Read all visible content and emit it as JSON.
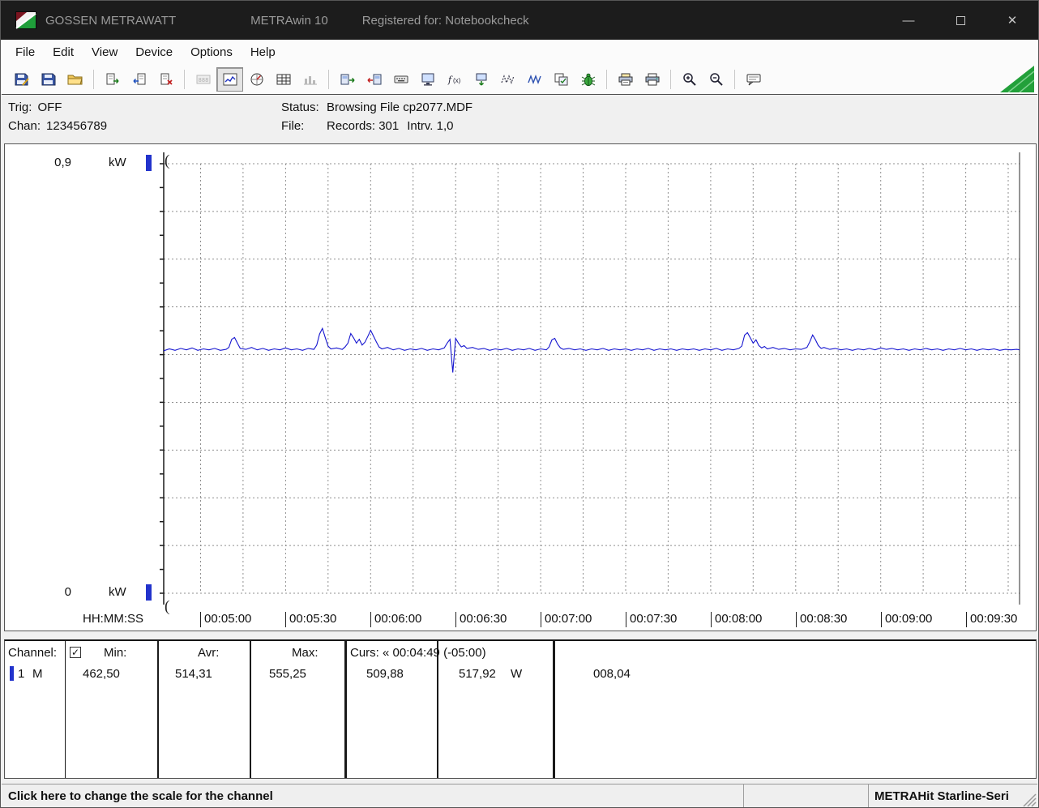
{
  "titlebar": {
    "app_name": "GOSSEN METRAWATT",
    "app_title": "METRAwin 10",
    "registered": "Registered for: Notebookcheck",
    "minimize_glyph": "—",
    "close_glyph": "✕"
  },
  "menu": {
    "items": [
      "File",
      "Edit",
      "View",
      "Device",
      "Options",
      "Help"
    ]
  },
  "toolbar": {
    "accent_triangle_color": "#22a03a",
    "groups": [
      [
        {
          "name": "save-record",
          "icon": "disk-pen"
        },
        {
          "name": "save-file",
          "icon": "disk"
        },
        {
          "name": "open-file",
          "icon": "folder"
        }
      ],
      [
        {
          "name": "export-data",
          "icon": "doc-right"
        },
        {
          "name": "import-data",
          "icon": "doc-left"
        },
        {
          "name": "close-file",
          "icon": "doc-red"
        }
      ],
      [
        {
          "name": "view-numeric",
          "icon": "lcd",
          "disabled": true
        },
        {
          "name": "view-trend-chart",
          "icon": "chart",
          "pressed": true
        },
        {
          "name": "view-analog-meter",
          "icon": "dial"
        },
        {
          "name": "view-table",
          "icon": "table"
        },
        {
          "name": "view-histogram",
          "icon": "bars",
          "disabled": true
        }
      ],
      [
        {
          "name": "device-send",
          "icon": "dev-send"
        },
        {
          "name": "device-receive",
          "icon": "dev-recv"
        },
        {
          "name": "device-program",
          "icon": "kbd"
        },
        {
          "name": "pc-transfer",
          "icon": "monitor"
        },
        {
          "name": "formula",
          "icon": "fx"
        },
        {
          "name": "device-memory",
          "icon": "mem"
        },
        {
          "name": "signal-dashed",
          "icon": "wave"
        },
        {
          "name": "signal-solid",
          "icon": "wave2"
        },
        {
          "name": "copy-settings",
          "icon": "copy"
        },
        {
          "name": "live-mode",
          "icon": "bug"
        }
      ],
      [
        {
          "name": "print-preview",
          "icon": "preview"
        },
        {
          "name": "print",
          "icon": "print"
        }
      ],
      [
        {
          "name": "zoom-in",
          "icon": "zoomin"
        },
        {
          "name": "zoom-out",
          "icon": "zoomout"
        }
      ],
      [
        {
          "name": "annotation",
          "icon": "note"
        }
      ]
    ]
  },
  "status_panel": {
    "trig_label": "Trig:",
    "trig_value": "OFF",
    "chan_label": "Chan:",
    "chan_value": "123456789",
    "status_label": "Status:",
    "status_value": "Browsing File cp2077.MDF",
    "file_label": "File:",
    "file_records": "Records: 301",
    "file_interval": "Intrv. 1,0"
  },
  "chart": {
    "y_max_label": "0,9",
    "y_min_label": "0",
    "y_unit": "kW",
    "x_axis_label": "HH:MM:SS",
    "line_color": "#1515cf",
    "marker_color": "#2233cc"
  },
  "chart_data": {
    "type": "line",
    "title": "",
    "xlabel": "HH:MM:SS",
    "ylabel": "kW",
    "ylim_kw": [
      0,
      0.9
    ],
    "y_gridline_step_kw": 0.1,
    "x_gridline_step_s": 15,
    "x_range_s": [
      287,
      589
    ],
    "x_ticks": [
      {
        "t": 300,
        "label": "00:05:00"
      },
      {
        "t": 330,
        "label": "00:05:30"
      },
      {
        "t": 360,
        "label": "00:06:00"
      },
      {
        "t": 390,
        "label": "00:06:30"
      },
      {
        "t": 420,
        "label": "00:07:00"
      },
      {
        "t": 450,
        "label": "00:07:30"
      },
      {
        "t": 480,
        "label": "00:08:00"
      },
      {
        "t": 510,
        "label": "00:08:30"
      },
      {
        "t": 540,
        "label": "00:09:00"
      },
      {
        "t": 570,
        "label": "00:09:30"
      }
    ],
    "cursors": {
      "c1_time": "00:04:49",
      "span": "(-05:00)",
      "c1_value_w": 509.88,
      "c2_value_w": 517.92,
      "delta_w": 8.04
    },
    "stats": {
      "min_w": 462.5,
      "avr_w": 514.31,
      "max_w": 555.25,
      "records": 301,
      "interval_s": 1.0
    },
    "series": [
      {
        "name": "Channel 1 power (W)",
        "color": "#1515cf",
        "points": [
          [
            287,
            508
          ],
          [
            289,
            512
          ],
          [
            291,
            509
          ],
          [
            293,
            513
          ],
          [
            295,
            510
          ],
          [
            297,
            514
          ],
          [
            299,
            509
          ],
          [
            301,
            512
          ],
          [
            303,
            510
          ],
          [
            305,
            513
          ],
          [
            307,
            509
          ],
          [
            309,
            511
          ],
          [
            310,
            515
          ],
          [
            311,
            532
          ],
          [
            312,
            536
          ],
          [
            313,
            524
          ],
          [
            314,
            513
          ],
          [
            316,
            511
          ],
          [
            318,
            515
          ],
          [
            320,
            510
          ],
          [
            322,
            513
          ],
          [
            324,
            509
          ],
          [
            326,
            512
          ],
          [
            328,
            510
          ],
          [
            330,
            514
          ],
          [
            332,
            510
          ],
          [
            334,
            512
          ],
          [
            336,
            509
          ],
          [
            338,
            513
          ],
          [
            340,
            511
          ],
          [
            341,
            520
          ],
          [
            342,
            543
          ],
          [
            343,
            555
          ],
          [
            344,
            536
          ],
          [
            345,
            518
          ],
          [
            346,
            512
          ],
          [
            348,
            514
          ],
          [
            350,
            511
          ],
          [
            351,
            516
          ],
          [
            352,
            524
          ],
          [
            353,
            544
          ],
          [
            354,
            535
          ],
          [
            355,
            524
          ],
          [
            356,
            532
          ],
          [
            357,
            520
          ],
          [
            358,
            526
          ],
          [
            359,
            538
          ],
          [
            360,
            551
          ],
          [
            361,
            539
          ],
          [
            362,
            527
          ],
          [
            363,
            516
          ],
          [
            364,
            512
          ],
          [
            366,
            515
          ],
          [
            368,
            510
          ],
          [
            370,
            513
          ],
          [
            372,
            509
          ],
          [
            374,
            512
          ],
          [
            376,
            510
          ],
          [
            378,
            513
          ],
          [
            380,
            509
          ],
          [
            382,
            512
          ],
          [
            384,
            510
          ],
          [
            386,
            514
          ],
          [
            387,
            524
          ],
          [
            388,
            532
          ],
          [
            389,
            462.5
          ],
          [
            390,
            534
          ],
          [
            391,
            524
          ],
          [
            392,
            516
          ],
          [
            393,
            519
          ],
          [
            394,
            513
          ],
          [
            396,
            515
          ],
          [
            398,
            511
          ],
          [
            400,
            513
          ],
          [
            402,
            509
          ],
          [
            404,
            512
          ],
          [
            406,
            510
          ],
          [
            408,
            513
          ],
          [
            410,
            509
          ],
          [
            412,
            512
          ],
          [
            414,
            510
          ],
          [
            416,
            513
          ],
          [
            418,
            509
          ],
          [
            420,
            512
          ],
          [
            422,
            510
          ],
          [
            423,
            516
          ],
          [
            424,
            531
          ],
          [
            425,
            534
          ],
          [
            426,
            522
          ],
          [
            427,
            514
          ],
          [
            428,
            511
          ],
          [
            430,
            513
          ],
          [
            432,
            510
          ],
          [
            434,
            512
          ],
          [
            436,
            509
          ],
          [
            438,
            512
          ],
          [
            440,
            510
          ],
          [
            442,
            513
          ],
          [
            444,
            509
          ],
          [
            446,
            512
          ],
          [
            448,
            510
          ],
          [
            450,
            512
          ],
          [
            452,
            509
          ],
          [
            454,
            512
          ],
          [
            456,
            510
          ],
          [
            458,
            513
          ],
          [
            460,
            509
          ],
          [
            462,
            512
          ],
          [
            464,
            510
          ],
          [
            466,
            512
          ],
          [
            468,
            509
          ],
          [
            470,
            512
          ],
          [
            472,
            510
          ],
          [
            474,
            512
          ],
          [
            476,
            509
          ],
          [
            478,
            512
          ],
          [
            480,
            510
          ],
          [
            482,
            513
          ],
          [
            484,
            509
          ],
          [
            486,
            512
          ],
          [
            488,
            510
          ],
          [
            490,
            513
          ],
          [
            491,
            518
          ],
          [
            492,
            541
          ],
          [
            493,
            546
          ],
          [
            494,
            535
          ],
          [
            495,
            524
          ],
          [
            496,
            531
          ],
          [
            497,
            519
          ],
          [
            498,
            514
          ],
          [
            499,
            517
          ],
          [
            500,
            512
          ],
          [
            502,
            515
          ],
          [
            504,
            511
          ],
          [
            506,
            513
          ],
          [
            508,
            510
          ],
          [
            510,
            512
          ],
          [
            512,
            511
          ],
          [
            514,
            515
          ],
          [
            515,
            527
          ],
          [
            516,
            541
          ],
          [
            517,
            531
          ],
          [
            518,
            519
          ],
          [
            519,
            513
          ],
          [
            520,
            515
          ],
          [
            522,
            511
          ],
          [
            524,
            513
          ],
          [
            526,
            510
          ],
          [
            528,
            512
          ],
          [
            530,
            509
          ],
          [
            532,
            512
          ],
          [
            534,
            510
          ],
          [
            536,
            513
          ],
          [
            538,
            510
          ],
          [
            540,
            514
          ],
          [
            542,
            511
          ],
          [
            544,
            513
          ],
          [
            546,
            510
          ],
          [
            548,
            512
          ],
          [
            550,
            509
          ],
          [
            552,
            512
          ],
          [
            554,
            510
          ],
          [
            556,
            513
          ],
          [
            558,
            510
          ],
          [
            560,
            512
          ],
          [
            562,
            509
          ],
          [
            564,
            512
          ],
          [
            566,
            510
          ],
          [
            568,
            513
          ],
          [
            570,
            510
          ],
          [
            572,
            512
          ],
          [
            574,
            509
          ],
          [
            576,
            512
          ],
          [
            578,
            510
          ],
          [
            580,
            512
          ],
          [
            582,
            509
          ],
          [
            584,
            511
          ],
          [
            586,
            510
          ],
          [
            588,
            511
          ],
          [
            589,
            510
          ]
        ]
      }
    ]
  },
  "table": {
    "header": {
      "channel": "Channel:",
      "min": "Min:",
      "avr": "Avr:",
      "max": "Max:",
      "curs": "Curs: « 00:04:49 (-05:00)"
    },
    "row": {
      "id": "1",
      "mode": "M",
      "min": "462,50",
      "avr": "514,31",
      "max": "555,25",
      "curs1": "509,88",
      "curs2": "517,92",
      "unit": "W",
      "delta": "008,04"
    }
  },
  "statusbar": {
    "left": "Click here to change the scale for the channel",
    "right": "METRAHit Starline-Seri"
  }
}
